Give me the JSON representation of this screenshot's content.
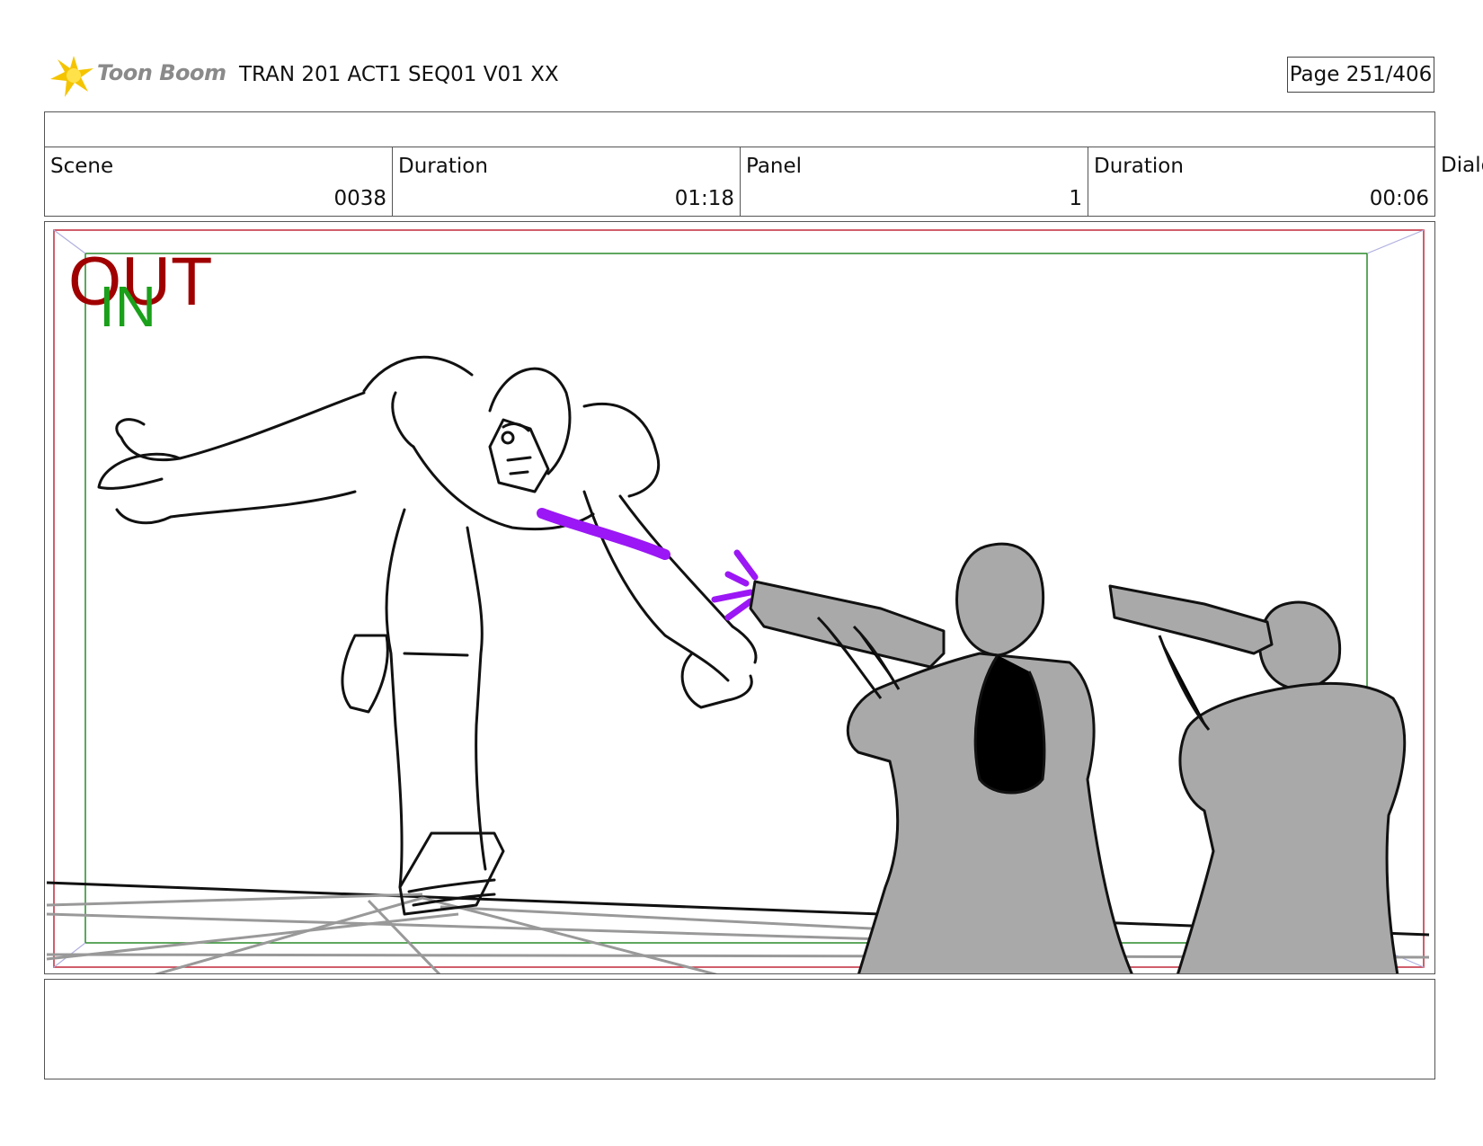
{
  "header": {
    "logo_text": "Toon Boom",
    "doc_title": "TRAN 201 ACT1 SEQ01 V01 XX",
    "page_label": "Page 251/406"
  },
  "info": {
    "scene_label": "Scene",
    "scene_value": "0038",
    "scene_duration_label": "Duration",
    "scene_duration_value": "01:18",
    "panel_label": "Panel",
    "panel_value": "1",
    "panel_duration_label": "Duration",
    "panel_duration_value": "00:06",
    "dialog_label": "Dialo"
  },
  "frame_labels": {
    "out": "OUT",
    "in": "IN",
    "out_color": "#a00000",
    "in_color": "#1aa01a"
  },
  "colors": {
    "border": "#555555",
    "effect": "#9b17f5",
    "figure_fill": "#a9a9a9",
    "ground_lines": "#999999"
  }
}
